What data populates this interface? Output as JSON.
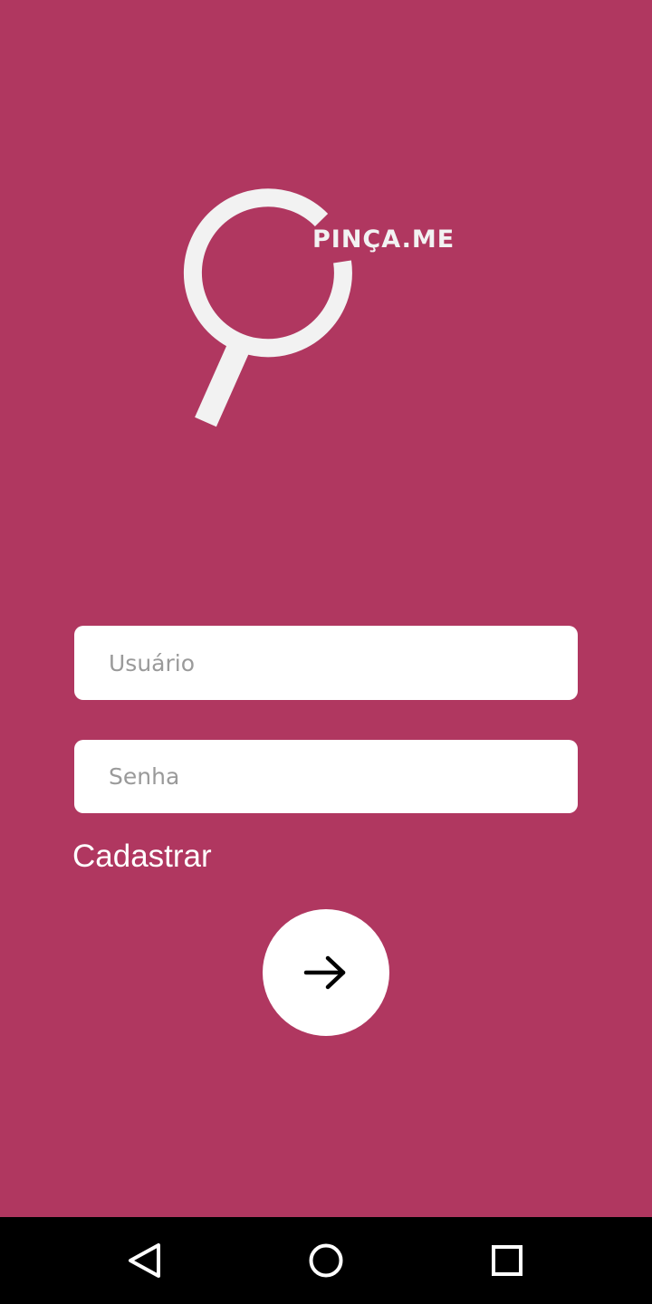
{
  "app": {
    "brand_name": "PINÇA.ME",
    "background_color": "#b03760",
    "logo_icon": "magnifier-logo-icon"
  },
  "login": {
    "username_placeholder": "Usuário",
    "password_placeholder": "Senha",
    "signup_label": "Cadastrar",
    "submit_icon": "arrow-right-icon"
  },
  "navigation_bar": {
    "back_icon": "back-triangle-icon",
    "home_icon": "home-circle-icon",
    "recents_icon": "recents-square-icon"
  }
}
